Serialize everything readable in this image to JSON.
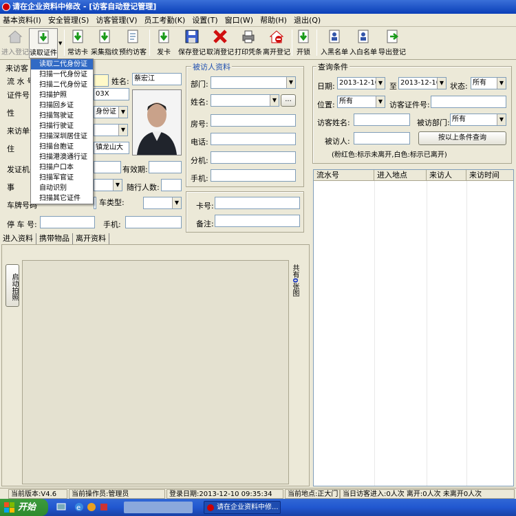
{
  "window": {
    "title": "请在企业资料中修改 - [访客自动登记管理]"
  },
  "menu": [
    "基本资料(I)",
    "安全管理(S)",
    "访客管理(V)",
    "员工考勤(K)",
    "设置(T)",
    "窗口(W)",
    "帮助(H)",
    "退出(Q)"
  ],
  "toolbar": {
    "items": [
      "进入登记",
      "读取证件",
      "常访卡",
      "采集指纹",
      "预约访客",
      "发卡",
      "保存登记",
      "取消登记",
      "打印凭条",
      "离开登记",
      "开锁",
      "入黑名单",
      "入白名单",
      "导出登记"
    ]
  },
  "dropdown": {
    "items": [
      "读取二代身份证",
      "扫描一代身份证",
      "扫描二代身份证",
      "扫描护照",
      "扫描回乡证",
      "扫描驾驶证",
      "扫描行驶证",
      "扫描深圳居住证",
      "扫描台胞证",
      "扫描港澳通行证",
      "扫描户口本",
      "扫描军官证",
      "自动识别",
      "扫描其它证件"
    ]
  },
  "visitor": {
    "group_title": "来访客",
    "serial_label": "流 水 号",
    "name_label": "姓名:",
    "name_value": "蔡宏江",
    "id_label": "证件号",
    "id_value": "03X",
    "gender_label": "性",
    "id_type_value": "身份证",
    "unit_label": "来访单位",
    "address_label": "住",
    "address_value": "镇龙山大",
    "issuer_label": "发证机关",
    "valid_label": "有效期:",
    "matter_label": "事",
    "companions_label": "随行人数:",
    "plate_label": "车牌号码",
    "car_type_label": "车类型:",
    "parking_label": "停 车 号:",
    "phone_label": "手机:"
  },
  "host": {
    "group_title": "被访人资料",
    "dept_label": "部门:",
    "name_label": "姓名:",
    "room_label": "房号:",
    "tel_label": "电话:",
    "ext_label": "分机:",
    "mobile_label": "手机:",
    "ellipsis": "...",
    "card_label": "卡号:",
    "remark_label": "备注:"
  },
  "query": {
    "group_title": "查询条件",
    "date_label": "日期:",
    "date_from": "2013-12-10",
    "to_label": "至",
    "date_to": "2013-12-10",
    "status_label": "状态:",
    "status_value": "所有",
    "location_label": "位置:",
    "location_value": "所有",
    "visitor_id_label": "访客证件号:",
    "visitor_name_label": "访客姓名:",
    "host_dept_label": "被访部门:",
    "host_dept_value": "所有",
    "host_label": "被访人:",
    "query_button": "按以上条件查询",
    "note": "(粉红色:标示未离开,白色:标示已离开)"
  },
  "grid": {
    "columns": [
      "流水号",
      "进入地点",
      "来访人",
      "来访时间"
    ]
  },
  "tabs": [
    "进入资料",
    "携带物品",
    "离开资料"
  ],
  "capture": {
    "start_button": "启动拍照",
    "count_prefix": "共有",
    "count": "0",
    "count_suffix": "张图"
  },
  "status": {
    "version": "当前版本:V4.6",
    "operator": "当前操作员:管理员",
    "login": "登录日期:2013-12-10 09:35:34",
    "location": "当前地点:正大门",
    "stats": "当日访客进入:0人次 离开:0人次 未离开0人次"
  },
  "taskbar": {
    "start": "开始",
    "task": "请在企业资料中修..."
  }
}
